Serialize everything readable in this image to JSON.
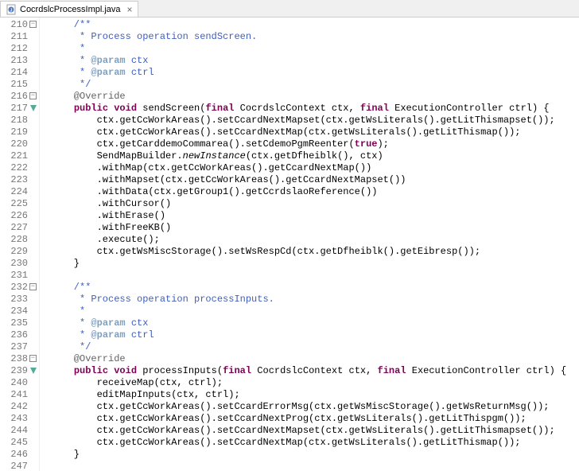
{
  "tab": {
    "filename": "CocrdslcProcessImpl.java",
    "close_glyph": "×"
  },
  "gutter": {
    "start": 210,
    "end": 247,
    "foldable": [
      210,
      216,
      232,
      238
    ],
    "override": [
      217,
      239
    ]
  },
  "code": [
    {
      "t": "javadoc",
      "text": "    /**"
    },
    {
      "t": "javadoc",
      "text": "     * Process operation sendScreen."
    },
    {
      "t": "javadoc",
      "text": "     *"
    },
    {
      "t": "javadoc-tag",
      "text": "     * @param ctx"
    },
    {
      "t": "javadoc-tag",
      "text": "     * @param ctrl"
    },
    {
      "t": "javadoc",
      "text": "     */"
    },
    {
      "t": "ann",
      "text": "    @Override"
    },
    {
      "t": "sig1",
      "text": ""
    },
    {
      "t": "plain",
      "text": "        ctx.getCcWorkAreas().setCcardNextMapset(ctx.getWsLiterals().getLitThismapset());"
    },
    {
      "t": "plain",
      "text": "        ctx.getCcWorkAreas().setCcardNextMap(ctx.getWsLiterals().getLitThismap());"
    },
    {
      "t": "true",
      "text": "        ctx.getCarddemoCommarea().setCdemoPgmReenter(true);"
    },
    {
      "t": "static",
      "text": "        SendMapBuilder.newInstance(ctx.getDfheiblk(), ctx)"
    },
    {
      "t": "plain",
      "text": "        .withMap(ctx.getCcWorkAreas().getCcardNextMap())"
    },
    {
      "t": "plain",
      "text": "        .withMapset(ctx.getCcWorkAreas().getCcardNextMapset())"
    },
    {
      "t": "plain",
      "text": "        .withData(ctx.getGroup1().getCcrdslaoReference())"
    },
    {
      "t": "plain",
      "text": "        .withCursor()"
    },
    {
      "t": "plain",
      "text": "        .withErase()"
    },
    {
      "t": "plain",
      "text": "        .withFreeKB()"
    },
    {
      "t": "plain",
      "text": "        .execute();"
    },
    {
      "t": "plain",
      "text": "        ctx.getWsMiscStorage().setWsRespCd(ctx.getDfheiblk().getEibresp());"
    },
    {
      "t": "plain",
      "text": "    }"
    },
    {
      "t": "plain",
      "text": ""
    },
    {
      "t": "javadoc",
      "text": "    /**"
    },
    {
      "t": "javadoc",
      "text": "     * Process operation processInputs."
    },
    {
      "t": "javadoc",
      "text": "     *"
    },
    {
      "t": "javadoc-tag",
      "text": "     * @param ctx"
    },
    {
      "t": "javadoc-tag",
      "text": "     * @param ctrl"
    },
    {
      "t": "javadoc",
      "text": "     */"
    },
    {
      "t": "ann",
      "text": "    @Override"
    },
    {
      "t": "sig2",
      "text": ""
    },
    {
      "t": "plain",
      "text": "        receiveMap(ctx, ctrl);"
    },
    {
      "t": "plain",
      "text": "        editMapInputs(ctx, ctrl);"
    },
    {
      "t": "plain",
      "text": "        ctx.getCcWorkAreas().setCcardErrorMsg(ctx.getWsMiscStorage().getWsReturnMsg());"
    },
    {
      "t": "plain",
      "text": "        ctx.getCcWorkAreas().setCcardNextProg(ctx.getWsLiterals().getLitThispgm());"
    },
    {
      "t": "plain",
      "text": "        ctx.getCcWorkAreas().setCcardNextMapset(ctx.getWsLiterals().getLitThismapset());"
    },
    {
      "t": "plain",
      "text": "        ctx.getCcWorkAreas().setCcardNextMap(ctx.getWsLiterals().getLitThismap());"
    },
    {
      "t": "plain",
      "text": "    }"
    },
    {
      "t": "plain",
      "text": ""
    }
  ],
  "sig1": {
    "pre": "    ",
    "kw1": "public",
    "kw2": "void",
    "name": " sendScreen(",
    "kw3": "final",
    "type1": " CocrdslcContext ctx, ",
    "kw4": "final",
    "type2": " ExecutionController ctrl) {"
  },
  "sig2": {
    "pre": "    ",
    "kw1": "public",
    "kw2": "void",
    "name": " processInputs(",
    "kw3": "final",
    "type1": " CocrdslcContext ctx, ",
    "kw4": "final",
    "type2": " ExecutionController ctrl) {"
  },
  "true_line": {
    "pre": "        ctx.getCarddemoCommarea().setCdemoPgmReenter(",
    "kw": "true",
    "post": ");"
  },
  "static_line": {
    "pre": "        SendMapBuilder.",
    "call": "newInstance",
    "post": "(ctx.getDfheiblk(), ctx)"
  }
}
